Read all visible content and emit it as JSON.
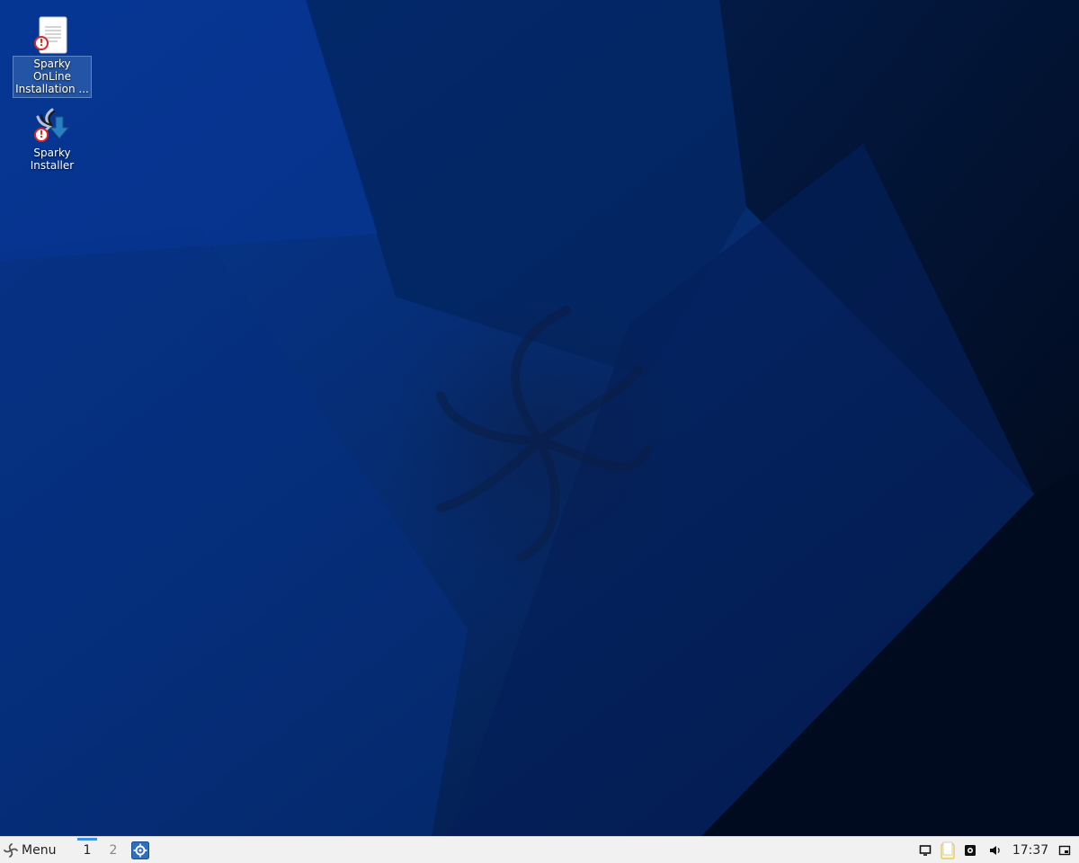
{
  "desktop": {
    "icons": [
      {
        "label": "Sparky\nOnLine\nInstallation ...",
        "icon": "text-document-icon",
        "badge": "warning-badge",
        "selected": true
      },
      {
        "label": "Sparky\nInstaller",
        "icon": "sparky-installer-icon",
        "badge": "warning-badge",
        "selected": false
      }
    ],
    "warning_symbol": "!"
  },
  "taskbar": {
    "menu_label": "Menu",
    "workspaces": [
      {
        "label": "1",
        "active": true
      },
      {
        "label": "2",
        "active": false
      }
    ],
    "launcher_icon": "system-settings-icon",
    "tray": [
      "screen-icon",
      "clipboard-icon",
      "screenshot-icon",
      "volume-icon"
    ],
    "clock": "17:37",
    "show_desktop_icon": "show-desktop-icon"
  },
  "colors": {
    "wallpaper_base": "#062a66",
    "wallpaper_dark": "#021028",
    "taskbar_bg": "#f1f1f1",
    "accent": "#3f8ee8"
  }
}
